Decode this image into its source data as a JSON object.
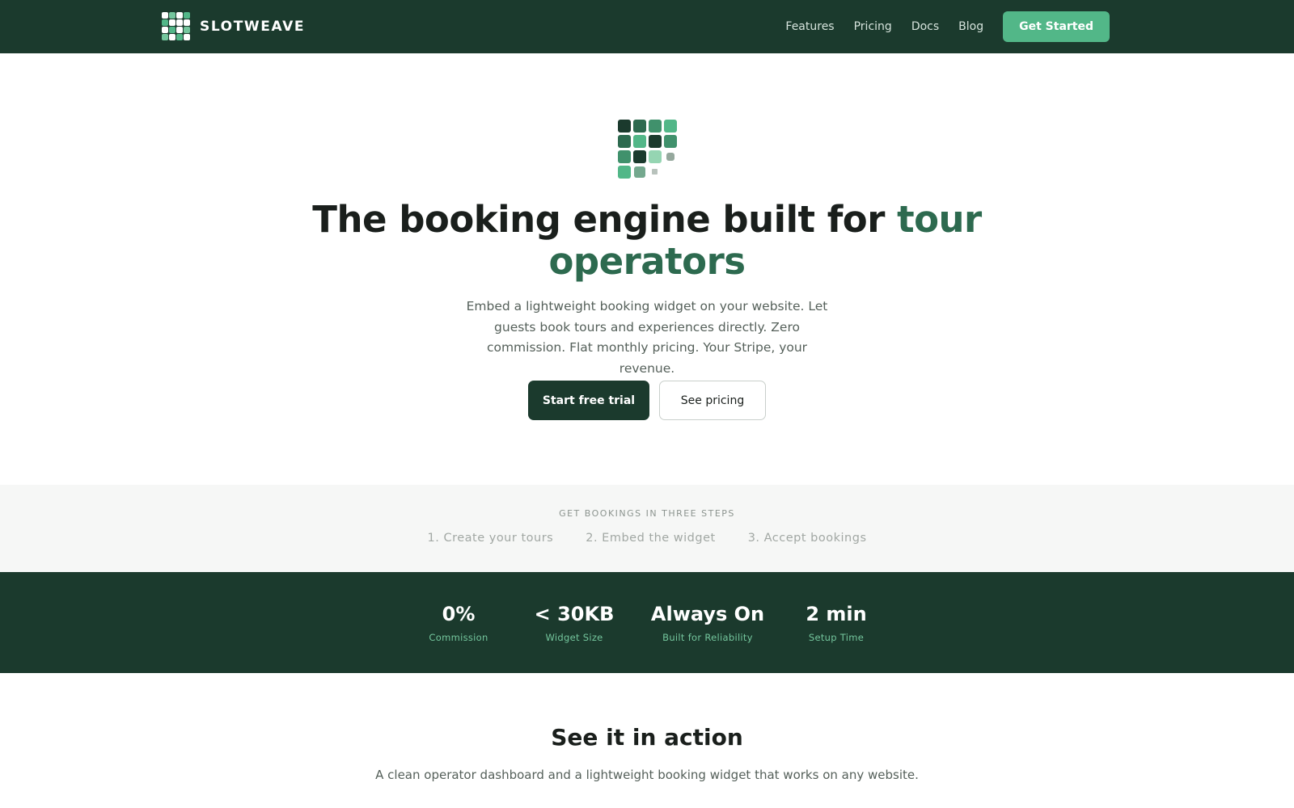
{
  "brand": {
    "name": "SLOTWEAVE",
    "logo_icon": "grid-logo-icon"
  },
  "nav": {
    "links": [
      "Features",
      "Pricing",
      "Docs",
      "Blog"
    ],
    "cta": "Get Started"
  },
  "hero": {
    "title_main": "The booking engine built for ",
    "title_accent": "tour operators",
    "subtitle": "Embed a lightweight booking widget on your website. Let guests book tours and experiences directly. Zero commission. Flat monthly pricing. Your Stripe, your revenue.",
    "primary_cta": "Start free trial",
    "secondary_cta": "See pricing"
  },
  "steps": {
    "title": "GET BOOKINGS IN THREE STEPS",
    "items": [
      "1. Create your tours",
      "2. Embed the widget",
      "3. Accept bookings"
    ]
  },
  "stats": [
    {
      "value": "0%",
      "label": "Commission"
    },
    {
      "value": "< 30KB",
      "label": "Widget Size"
    },
    {
      "value": "Always On",
      "label": "Built for Reliability"
    },
    {
      "value": "2 min",
      "label": "Setup Time"
    }
  ],
  "action": {
    "title": "See it in action",
    "subtitle": "A clean operator dashboard and a lightweight booking widget that works on any website."
  },
  "colors": {
    "brand_dark": "#1b3a2d",
    "brand_green": "#2d6a4f",
    "accent_green": "#52b788",
    "light_green": "#74c69d"
  }
}
